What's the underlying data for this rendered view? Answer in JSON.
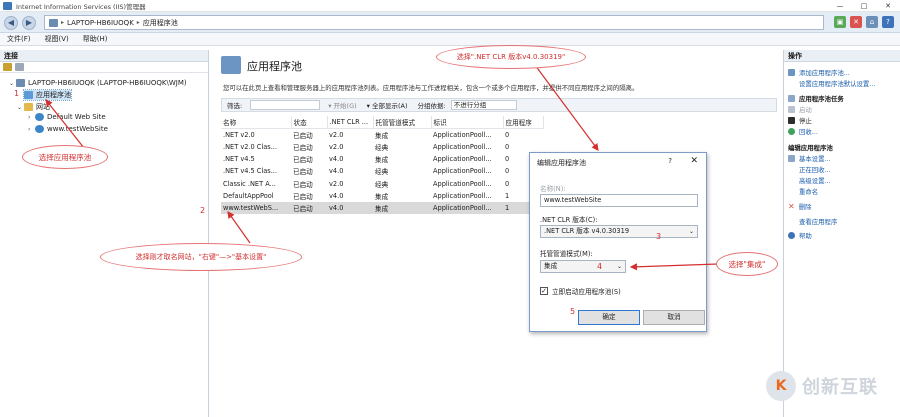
{
  "window": {
    "title": "Internet Information Services (IIS)管理器",
    "controls": [
      "—",
      "□",
      "✕"
    ]
  },
  "nav": {
    "crumbs": [
      "LAPTOP-HB6IUOQK",
      "应用程序池"
    ],
    "separator": "▸"
  },
  "menu": [
    "文件(F)",
    "视图(V)",
    "帮助(H)"
  ],
  "left": {
    "header": "连接",
    "tree": [
      {
        "label": "LAPTOP-HB6IUOQK (LAPTOP-HB6IUOQK\\WJM)",
        "exp": "⌄",
        "icon": "server-icon"
      },
      {
        "label": "应用程序池",
        "exp": "",
        "icon": "app-pool-icon"
      },
      {
        "label": "网站",
        "exp": "⌄",
        "icon": "folder-icon"
      },
      {
        "label": "Default Web Site",
        "exp": "›",
        "icon": "globe-icon"
      },
      {
        "label": "www.testWebSite",
        "exp": "›",
        "icon": "globe-icon"
      }
    ]
  },
  "center": {
    "title": "应用程序池",
    "description": "您可以在此页上查看和管理服务器上的应用程序池列表。应用程序池与工作进程相关，包含一个或多个应用程序，并提供不同应用程序之间的隔离。",
    "filter": {
      "label": "筛选:",
      "go": "▾ 开始(G)",
      "show_all": "▾ 全部显示(A)",
      "group_by": "分组依据:",
      "group_value": "不进行分组"
    },
    "columns": [
      "名称",
      "状态",
      ".NET CLR ...",
      "托管管道模式",
      "标识",
      "应用程序"
    ],
    "rows": [
      [
        ".NET v2.0",
        "已启动",
        "v2.0",
        "集成",
        "ApplicationPooll...",
        "0"
      ],
      [
        ".NET v2.0 Clas...",
        "已启动",
        "v2.0",
        "经典",
        "ApplicationPooll...",
        "0"
      ],
      [
        ".NET v4.5",
        "已启动",
        "v4.0",
        "集成",
        "ApplicationPooll...",
        "0"
      ],
      [
        ".NET v4.5 Clas...",
        "已启动",
        "v4.0",
        "经典",
        "ApplicationPooll...",
        "0"
      ],
      [
        "Classic .NET A...",
        "已启动",
        "v2.0",
        "经典",
        "ApplicationPooll...",
        "0"
      ],
      [
        "DefaultAppPool",
        "已启动",
        "v4.0",
        "集成",
        "ApplicationPooll...",
        "1"
      ],
      [
        "www.testWebS...",
        "已启动",
        "v4.0",
        "集成",
        "ApplicationPooll...",
        "1"
      ]
    ]
  },
  "right": {
    "header": "操作",
    "items": [
      {
        "label": "添加应用程序池...",
        "kind": "link"
      },
      {
        "label": "设置应用程序池默认设置...",
        "kind": "link"
      },
      {
        "label": "应用程序池任务",
        "kind": "head"
      },
      {
        "label": "启动",
        "kind": "dis"
      },
      {
        "label": "停止",
        "kind": "normal"
      },
      {
        "label": "回收...",
        "kind": "link"
      },
      {
        "label": "编辑应用程序池",
        "kind": "head"
      },
      {
        "label": "基本设置...",
        "kind": "link"
      },
      {
        "label": "正在回收...",
        "kind": "link"
      },
      {
        "label": "高级设置...",
        "kind": "link"
      },
      {
        "label": "重命名",
        "kind": "link"
      },
      {
        "label": "删除",
        "kind": "link"
      },
      {
        "label": "查看应用程序",
        "kind": "link"
      },
      {
        "label": "帮助",
        "kind": "link"
      }
    ]
  },
  "dialog": {
    "title": "编辑应用程序池",
    "help": "?",
    "close": "✕",
    "name_label": "名称(N):",
    "name_value": "www.testWebSite",
    "clr_label": ".NET CLR 版本(C):",
    "clr_value": ".NET CLR 版本 v4.0.30319",
    "pipeline_label": "托管管道模式(M):",
    "pipeline_value": "集成",
    "autostart_label": "立即启动应用程序池(S)",
    "autostart_checked": true,
    "ok": "确定",
    "cancel": "取消"
  },
  "annotations": {
    "select_pool": "选择应用程序池",
    "right_click": "选择刚才取名网站，\"右键\"—>\"基本设置\"",
    "select_clr": "选择\".NET CLR 版本v4.0.30319\"",
    "select_integrated": "选择\"集成\"",
    "n1": "1",
    "n2": "2",
    "n3": "3",
    "n4": "4",
    "n5": "5"
  },
  "brand": {
    "mark": "K",
    "text": "创新互联"
  },
  "colors": {
    "annotation": "#d32f2f",
    "link": "#1a5dab",
    "selection": "#cde4f7"
  }
}
